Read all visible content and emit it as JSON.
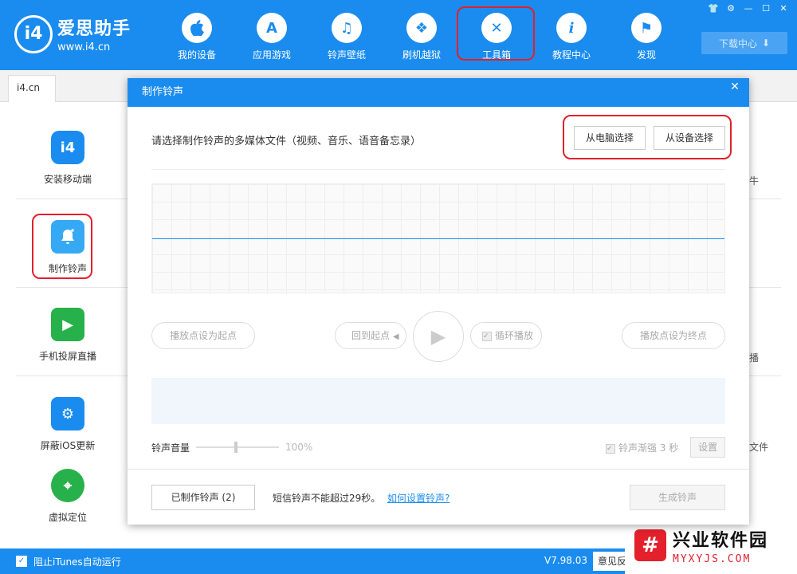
{
  "app": {
    "name": "爱思助手",
    "url": "www.i4.cn",
    "logo_text": "i4"
  },
  "nav": [
    {
      "label": "我的设备",
      "icon": "apple-icon",
      "glyph": ""
    },
    {
      "label": "应用游戏",
      "icon": "appstore-icon",
      "glyph": "A"
    },
    {
      "label": "铃声壁纸",
      "icon": "music-icon",
      "glyph": "♫"
    },
    {
      "label": "刷机越狱",
      "icon": "box-icon",
      "glyph": "❖"
    },
    {
      "label": "工具箱",
      "icon": "tools-icon",
      "glyph": "✕"
    },
    {
      "label": "教程中心",
      "icon": "info-icon",
      "glyph": "i"
    },
    {
      "label": "发现",
      "icon": "flag-icon",
      "glyph": "⚑"
    }
  ],
  "window_controls": {
    "shirt": "👕",
    "gear": "⚙",
    "min": "—",
    "max": "☐",
    "close": "✕"
  },
  "download": {
    "label": "下载中心",
    "icon": "⬇"
  },
  "tab": {
    "label": "i4.cn"
  },
  "tools": [
    {
      "label": "安装移动端",
      "icon": "i4-app-icon",
      "glyph": "i4",
      "color": "#1a8cef"
    },
    {
      "label": "制作铃声",
      "icon": "bell-icon",
      "glyph": "🔔",
      "color": "#36a9f5"
    },
    {
      "label": "手机投屏直播",
      "icon": "screen-cast-icon",
      "glyph": "▶",
      "color": "#27b14a"
    },
    {
      "label": "屏蔽iOS更新",
      "icon": "gear-block-icon",
      "glyph": "⚙",
      "color": "#1a8cef"
    },
    {
      "label": "虚拟定位",
      "icon": "location-icon",
      "glyph": "⌖",
      "color": "#27b14a"
    }
  ],
  "right_partial": [
    "牛",
    "播",
    "文件"
  ],
  "status": {
    "itunes_label": "阻止iTunes自动运行",
    "check": "✓",
    "version": "V7.98.03",
    "feedback": "意见反"
  },
  "watermark": {
    "glyph": "#",
    "title": "兴业软件园",
    "url": "MYXYJS.COM"
  },
  "dialog": {
    "title": "制作铃声",
    "close": "✕",
    "prompt": "请选择制作铃声的多媒体文件（视频、音乐、语音备忘录）",
    "from_pc": "从电脑选择",
    "from_device": "从设备选择",
    "set_start": "播放点设为起点",
    "back_to_start": "回到起点",
    "back_icon": "◀",
    "play_icon": "▶",
    "loop_label": "循环播放",
    "check": "✓",
    "set_end": "播放点设为终点",
    "volume_label": "铃声音量",
    "volume_percent": "100%",
    "volume_value": 1.0,
    "fade_label": "铃声渐强 3 秒",
    "settings": "设置",
    "made_button": "已制作铃声 (2)",
    "limit_text": "短信铃声不能超过29秒。",
    "howto_link": "如何设置铃声?",
    "generate": "生成铃声"
  }
}
